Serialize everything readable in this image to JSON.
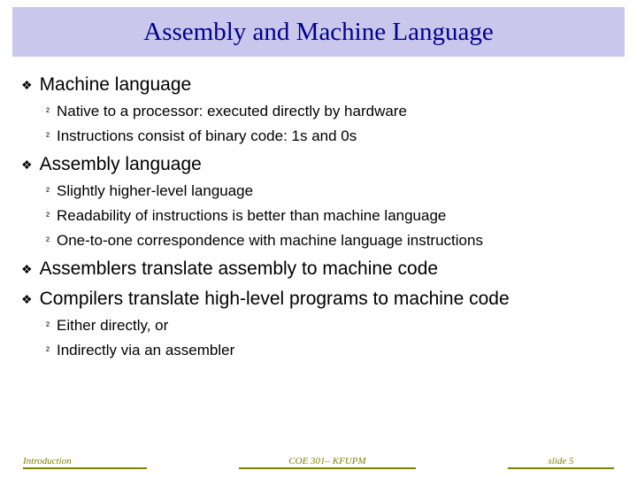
{
  "title": "Assembly and Machine Language",
  "items": [
    {
      "level": 1,
      "text": "Machine language"
    },
    {
      "level": 2,
      "text": "Native to a processor: executed directly by hardware"
    },
    {
      "level": 2,
      "text": "Instructions consist of binary code: 1s and 0s"
    },
    {
      "level": 1,
      "text": "Assembly language"
    },
    {
      "level": 2,
      "text": "Slightly higher-level language"
    },
    {
      "level": 2,
      "text": "Readability of instructions is better than machine language"
    },
    {
      "level": 2,
      "text": "One-to-one correspondence with machine language instructions"
    },
    {
      "level": 1,
      "text": "Assemblers translate assembly to machine code"
    },
    {
      "level": 1,
      "text": "Compilers translate high-level programs to machine code"
    },
    {
      "level": 2,
      "text": "Either directly, or"
    },
    {
      "level": 2,
      "text": "Indirectly via an assembler"
    }
  ],
  "bullets": {
    "l1": "❖",
    "l2": "²"
  },
  "footer": {
    "left": "Introduction",
    "center": "COE 301– KFUPM",
    "right": "slide 5"
  }
}
